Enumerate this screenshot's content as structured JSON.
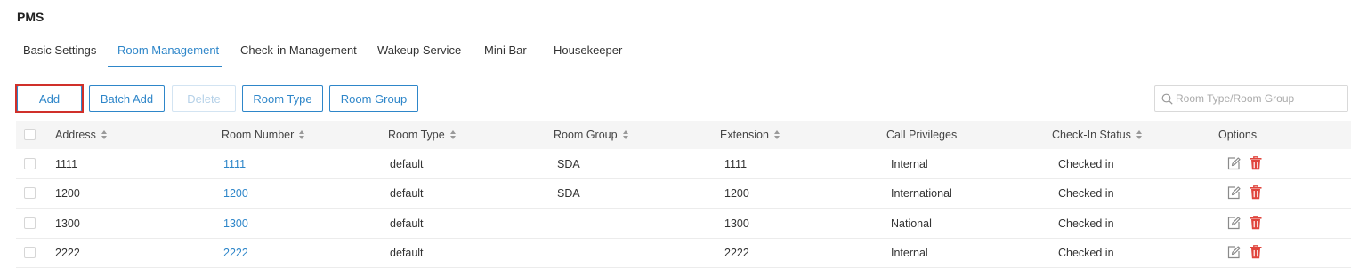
{
  "page": {
    "title": "PMS"
  },
  "tabs": [
    {
      "label": "Basic Settings",
      "active": false
    },
    {
      "label": "Room Management",
      "active": true
    },
    {
      "label": "Check-in Management",
      "active": false
    },
    {
      "label": "Wakeup Service",
      "active": false
    },
    {
      "label": "Mini Bar",
      "active": false
    },
    {
      "label": "Housekeeper",
      "active": false
    }
  ],
  "toolbar": {
    "add_label": "Add",
    "batch_add_label": "Batch Add",
    "delete_label": "Delete",
    "room_type_label": "Room Type",
    "room_group_label": "Room Group",
    "search_placeholder": "Room Type/Room Group",
    "search_value": ""
  },
  "table": {
    "columns": {
      "address": "Address",
      "room_number": "Room Number",
      "room_type": "Room Type",
      "room_group": "Room Group",
      "extension": "Extension",
      "call_privileges": "Call Privileges",
      "checkin_status": "Check-In Status",
      "options": "Options"
    },
    "rows": [
      {
        "address": "1111",
        "room_number": "1111",
        "room_type": "default",
        "room_group": "SDA",
        "extension": "1111",
        "call_privileges": "Internal",
        "checkin_status": "Checked in"
      },
      {
        "address": "1200",
        "room_number": "1200",
        "room_type": "default",
        "room_group": "SDA",
        "extension": "1200",
        "call_privileges": "International",
        "checkin_status": "Checked in"
      },
      {
        "address": "1300",
        "room_number": "1300",
        "room_type": "default",
        "room_group": "",
        "extension": "1300",
        "call_privileges": "National",
        "checkin_status": "Checked in"
      },
      {
        "address": "2222",
        "room_number": "2222",
        "room_type": "default",
        "room_group": "",
        "extension": "2222",
        "call_privileges": "Internal",
        "checkin_status": "Checked in"
      }
    ]
  },
  "icons": {
    "edit": "edit-icon",
    "delete": "trash-icon",
    "search": "search-icon",
    "sort": "sort-icon"
  },
  "colors": {
    "accent": "#2e86c9",
    "danger": "#e0453d",
    "highlight": "#d0302a"
  }
}
